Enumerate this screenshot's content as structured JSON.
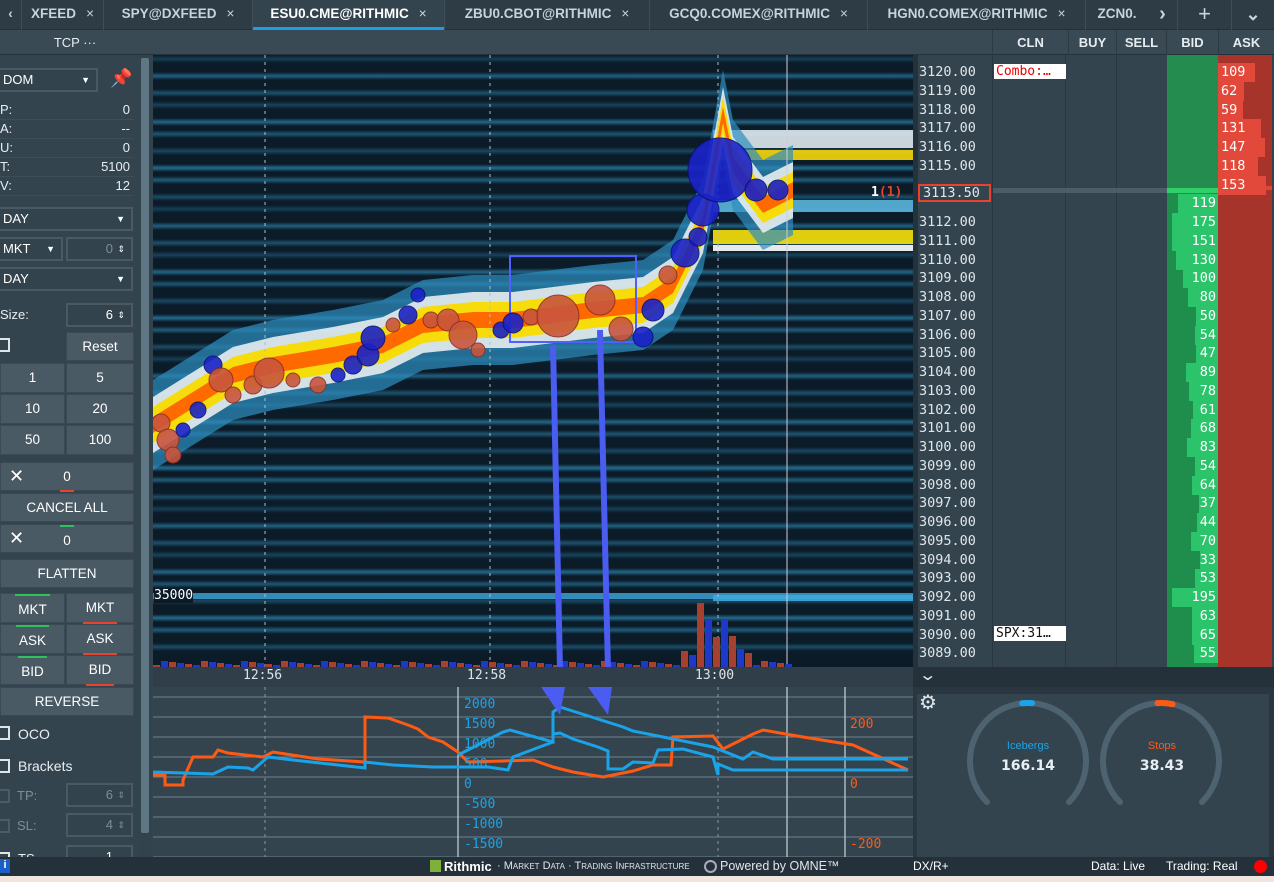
{
  "tabs": [
    {
      "label": "XFEED",
      "active": false
    },
    {
      "label": "SPY@DXFEED",
      "active": false
    },
    {
      "label": "ESU0.CME@RITHMIC",
      "active": true
    },
    {
      "label": "ZBU0.CBOT@RITHMIC",
      "active": false
    },
    {
      "label": "GCQ0.COMEX@RITHMIC",
      "active": false
    },
    {
      "label": "HGN0.COMEX@RITHMIC",
      "active": false
    },
    {
      "label": "ZCN0.",
      "active": false
    }
  ],
  "tab_close": "×",
  "tab_nav": {
    "prev": "‹",
    "next": "›",
    "add": "+",
    "menu": "⌄"
  },
  "left": {
    "title": "TCP ···",
    "mode": "DOM",
    "stats": [
      {
        "k": "P:",
        "v": "0"
      },
      {
        "k": "A:",
        "v": "--"
      },
      {
        "k": "U:",
        "v": "0"
      },
      {
        "k": "T:",
        "v": "5100"
      },
      {
        "k": "V:",
        "v": "12"
      }
    ],
    "tif1": "DAY",
    "order_type": "MKT",
    "price": "0",
    "tif2": "DAY",
    "size_label": "Size:",
    "size": "6",
    "reset": "Reset",
    "qty": [
      "1",
      "5",
      "10",
      "20",
      "50",
      "100"
    ],
    "sell_count": "0",
    "cancel_all": "CANCEL ALL",
    "buy_count": "0",
    "flatten": "FLATTEN",
    "buy_btns": [
      "MKT",
      "ASK",
      "BID"
    ],
    "sell_btns": [
      "MKT",
      "ASK",
      "BID"
    ],
    "reverse": "REVERSE",
    "oco": "OCO",
    "brackets": "Brackets",
    "tp_label": "TP:",
    "tp": "6",
    "sl_label": "SL:",
    "sl": "4",
    "ts_label": "TS",
    "ts": "1"
  },
  "chart": {
    "scale_label": "35000",
    "times": [
      "12:56",
      "12:58",
      "13:00"
    ],
    "lower_left_axis": [
      "2000",
      "1500",
      "1000",
      "500",
      "0",
      "-500",
      "-1000",
      "-1500"
    ],
    "lower_right_axis": [
      "200",
      "0",
      "-200"
    ],
    "colors": {
      "icebergs": "#1aa3e8",
      "stops": "#ff5a14"
    }
  },
  "dom": {
    "headers": [
      "CLN",
      "BUY",
      "SELL",
      "BID",
      "ASK"
    ],
    "current_price": "3113.50",
    "current_pos": "1",
    "current_pos_paren": "(1)",
    "combo_label": "Combo:…",
    "spx_label": "SPX:31…",
    "rows": [
      {
        "p": "3120.00",
        "a": "109"
      },
      {
        "p": "3119.00",
        "a": "62"
      },
      {
        "p": "3118.00",
        "a": "59"
      },
      {
        "p": "3117.00",
        "a": "131"
      },
      {
        "p": "3116.00",
        "a": "147"
      },
      {
        "p": "3115.00",
        "a": "118"
      },
      {
        "p": "",
        "a": "153"
      },
      {
        "p": "",
        "b": "119"
      },
      {
        "p": "3112.00",
        "b": "175"
      },
      {
        "p": "3111.00",
        "b": "151"
      },
      {
        "p": "3110.00",
        "b": "130"
      },
      {
        "p": "3109.00",
        "b": "100"
      },
      {
        "p": "3108.00",
        "b": "80"
      },
      {
        "p": "3107.00",
        "b": "50"
      },
      {
        "p": "3106.00",
        "b": "54"
      },
      {
        "p": "3105.00",
        "b": "47"
      },
      {
        "p": "3104.00",
        "b": "89"
      },
      {
        "p": "3103.00",
        "b": "78"
      },
      {
        "p": "3102.00",
        "b": "61"
      },
      {
        "p": "3101.00",
        "b": "68"
      },
      {
        "p": "3100.00",
        "b": "83"
      },
      {
        "p": "3099.00",
        "b": "54"
      },
      {
        "p": "3098.00",
        "b": "64"
      },
      {
        "p": "3097.00",
        "b": "37"
      },
      {
        "p": "3096.00",
        "b": "44"
      },
      {
        "p": "3095.00",
        "b": "70"
      },
      {
        "p": "3094.00",
        "b": "33"
      },
      {
        "p": "3093.00",
        "b": "53"
      },
      {
        "p": "3092.00",
        "b": "195"
      },
      {
        "p": "3091.00",
        "b": "63"
      },
      {
        "p": "3090.00",
        "b": "65"
      },
      {
        "p": "3089.00",
        "b": "55"
      }
    ]
  },
  "gauges": [
    {
      "label": "Icebergs",
      "value": "166.14",
      "color": "#1aa3e8"
    },
    {
      "label": "Stops",
      "value": "38.43",
      "color": "#ff5a14"
    }
  ],
  "status": {
    "brand": "Rithmic",
    "tagline": "· Market Data · Trading Infrastructure",
    "powered": "Powered by OMNE™",
    "feed": "DX/R+",
    "data": "Data: Live",
    "trading": "Trading: Real",
    "indicator_color": "#ff0000"
  }
}
